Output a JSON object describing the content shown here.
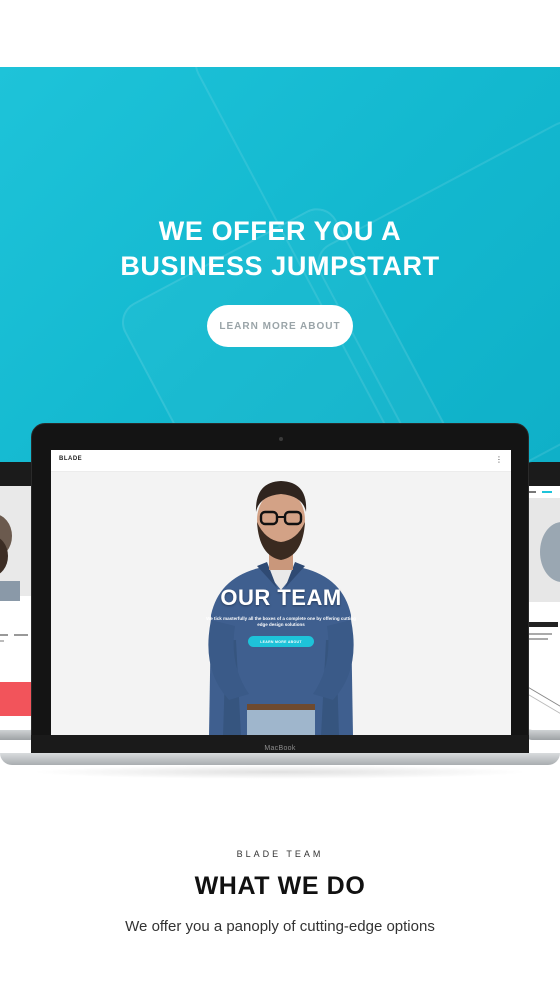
{
  "hero": {
    "title_line1": "WE OFFER YOU A",
    "title_line2": "BUSINESS JUMPSTART",
    "button_label": "LEARN MORE ABOUT",
    "accent_color": "#1ec3d9"
  },
  "laptop": {
    "brand": "MacBook",
    "screen": {
      "logo": "BLADE",
      "menu_icon": "dots-vertical-icon",
      "title": "OUR TEAM",
      "subtitle": "We tick masterfully all the boxes of a complete one by offering cutting edge design solutions",
      "button_label": "LEARN MORE ABOUT"
    }
  },
  "section": {
    "kicker": "BLADE TEAM",
    "title": "WHAT WE DO",
    "description": "We offer you a panoply of cutting-edge options"
  }
}
